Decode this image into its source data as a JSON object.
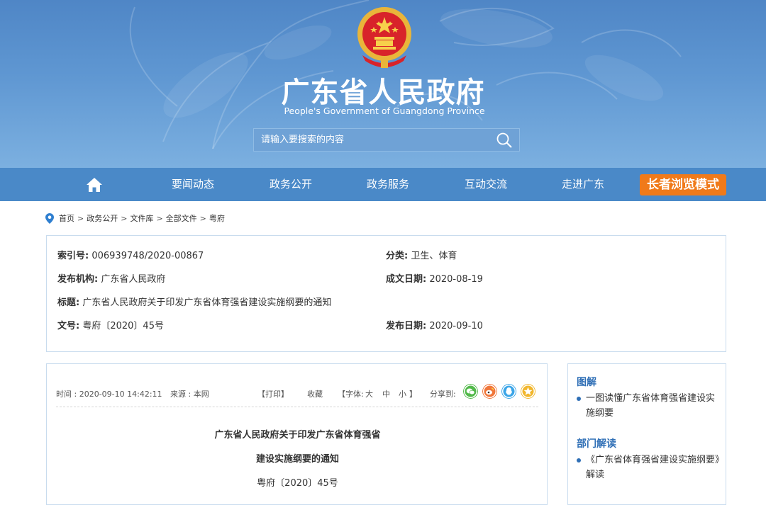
{
  "header": {
    "title": "广东省人民政府",
    "subtitle": "People's Government of Guangdong Province",
    "search_placeholder": "请输入要搜索的内容"
  },
  "nav": {
    "items": [
      "要闻动态",
      "政务公开",
      "政务服务",
      "互动交流",
      "走进广东"
    ],
    "elder_mode": "长者浏览模式"
  },
  "breadcrumb": [
    "首页",
    "政务公开",
    "文件库",
    "全部文件",
    "粤府"
  ],
  "info": {
    "index_label": "索引号:",
    "index_value": "006939748/2020-00867",
    "category_label": "分类:",
    "category_value": "卫生、体育",
    "issuer_label": "发布机构:",
    "issuer_value": "广东省人民政府",
    "written_label": "成文日期:",
    "written_value": "2020-08-19",
    "title_label": "标题:",
    "title_value": "广东省人民政府关于印发广东省体育强省建设实施纲要的通知",
    "docno_label": "文号:",
    "docno_value": "粤府〔2020〕45号",
    "published_label": "发布日期:",
    "published_value": "2020-09-10"
  },
  "article": {
    "time": "时间 : 2020-09-10 14:42:11",
    "source": "来源 : 本网",
    "print": "【打印】",
    "favorite": "收藏",
    "font_prefix": "【字体:",
    "font_large": "大",
    "font_medium": "中",
    "font_small": "小",
    "font_suffix": "】",
    "share_to": "分享到:",
    "title_line1": "广东省人民政府关于印发广东省体育强省",
    "title_line2": "建设实施纲要的通知",
    "doc_number": "粤府〔2020〕45号"
  },
  "sidebar": {
    "section1_title": "图解",
    "section1_item": "一图读懂广东省体育强省建设实施纲要",
    "section2_title": "部门解读",
    "section2_item": "《广东省体育强省建设实施纲要》解读"
  },
  "colors": {
    "header_blue": "#5f97d2",
    "nav_blue": "#4a89c8",
    "elder_orange": "#f07a1a",
    "link_blue": "#2f6fb6",
    "wechat_green": "#52b94a",
    "weibo_orange": "#f0763a",
    "qq_blue": "#3aa5e8",
    "qzone_yellow": "#f1b62c"
  }
}
